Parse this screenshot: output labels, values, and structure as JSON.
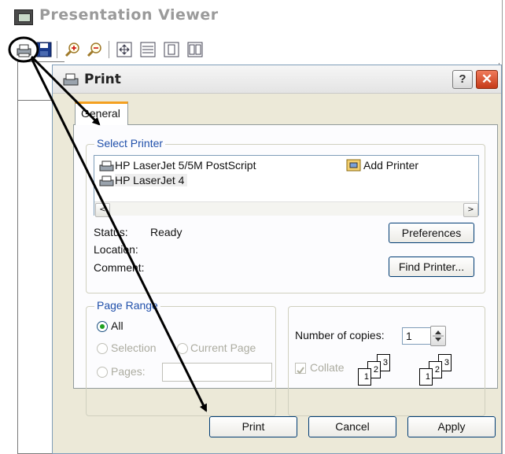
{
  "viewer": {
    "title": "Presentation Viewer",
    "toolbar_icons": [
      "print-icon",
      "save-icon",
      "zoom-in-icon",
      "zoom-out-icon",
      "fit-page-icon",
      "fit-width-icon",
      "single-page-icon",
      "two-page-icon"
    ]
  },
  "dialog": {
    "title": "Print",
    "help_label": "?",
    "close_label": "✕",
    "tab_general": "General",
    "select_printer": {
      "group_label": "Select Printer",
      "printers": [
        "HP LaserJet 5/5M PostScript",
        "HP LaserJet 4"
      ],
      "add_printer": "Add Printer",
      "scroll_left": "<",
      "scroll_right": ">"
    },
    "status_label": "Status:",
    "status_value": "Ready",
    "location_label": "Location:",
    "comment_label": "Comment:",
    "preferences_button": "Preferences",
    "find_printer_button": "Find Printer...",
    "page_range": {
      "group_label": "Page Range",
      "all": "All",
      "selection": "Selection",
      "current_page": "Current Page",
      "pages": "Pages:"
    },
    "copies": {
      "number_label": "Number of copies:",
      "number_value": "1",
      "collate": "Collate",
      "collate_pages": [
        "1",
        "2",
        "3",
        "1",
        "2",
        "3"
      ]
    },
    "print_button": "Print",
    "cancel_button": "Cancel",
    "apply_button": "Apply"
  },
  "colors": {
    "accent_group_label": "#1f4faa",
    "tab_highlight": "#f4a020",
    "close_button": "#c53a18",
    "annotation": "#000000"
  }
}
